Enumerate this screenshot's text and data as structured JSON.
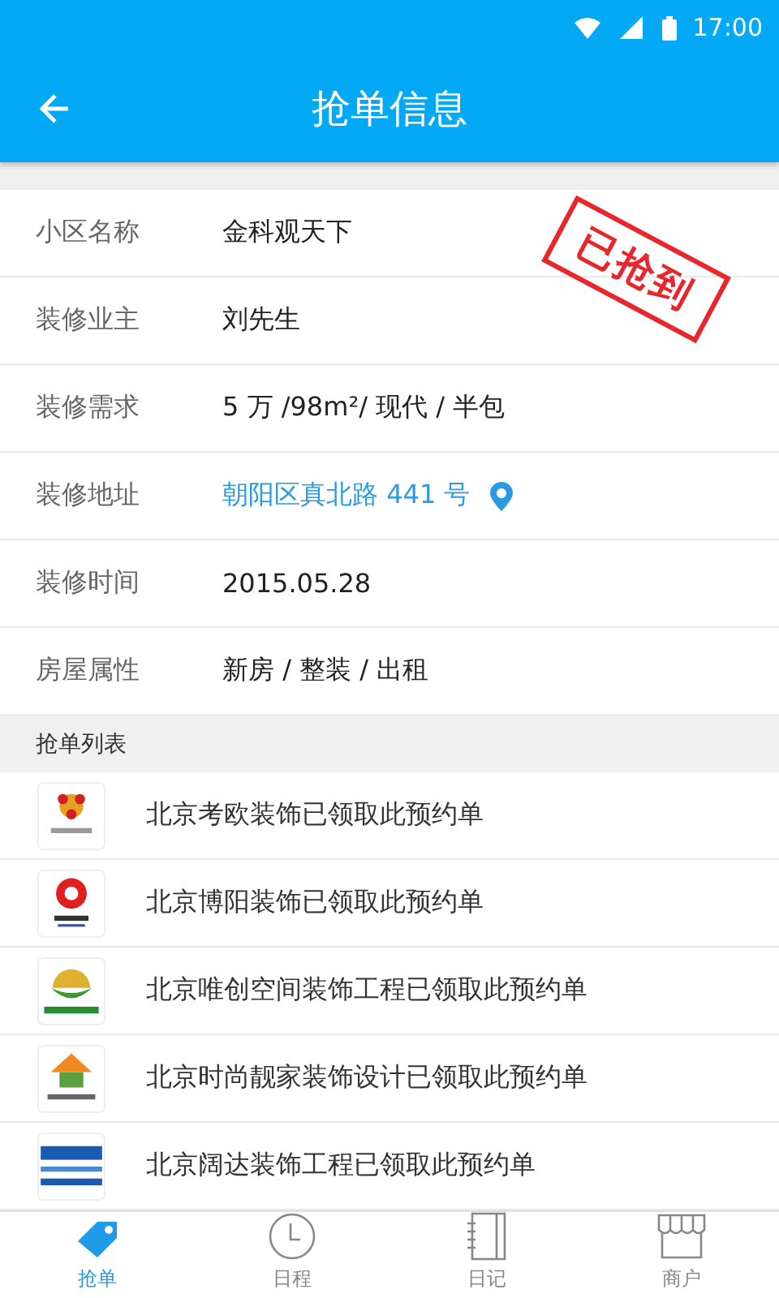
{
  "status_bar": {
    "time": "17:00"
  },
  "app_bar": {
    "title": "抢单信息"
  },
  "stamp": "已抢到",
  "details": [
    {
      "kind": "text",
      "label": "小区名称",
      "value": "金科观天下"
    },
    {
      "kind": "text",
      "label": "装修业主",
      "value": "刘先生"
    },
    {
      "kind": "text",
      "label": "装修需求",
      "value": "5 万 /98m²/ 现代 / 半包"
    },
    {
      "kind": "address",
      "label": "装修地址",
      "value": "朝阳区真北路 441 号"
    },
    {
      "kind": "text",
      "label": "装修时间",
      "value": "2015.05.28"
    },
    {
      "kind": "text",
      "label": "房屋属性",
      "value": "新房 / 整装 / 出租"
    }
  ],
  "list_title": "抢单列表",
  "grabs": [
    {
      "text": "北京考欧装饰已领取此预约单"
    },
    {
      "text": "北京博阳装饰已领取此预约单"
    },
    {
      "text": "北京唯创空间装饰工程已领取此预约单"
    },
    {
      "text": "北京时尚靓家装饰设计已领取此预约单"
    },
    {
      "text": "北京阔达装饰工程已领取此预约单"
    }
  ],
  "tabs": [
    {
      "label": "抢单",
      "selected": true
    },
    {
      "label": "日程",
      "selected": false
    },
    {
      "label": "日记",
      "selected": false
    },
    {
      "label": "商户",
      "selected": false
    }
  ]
}
